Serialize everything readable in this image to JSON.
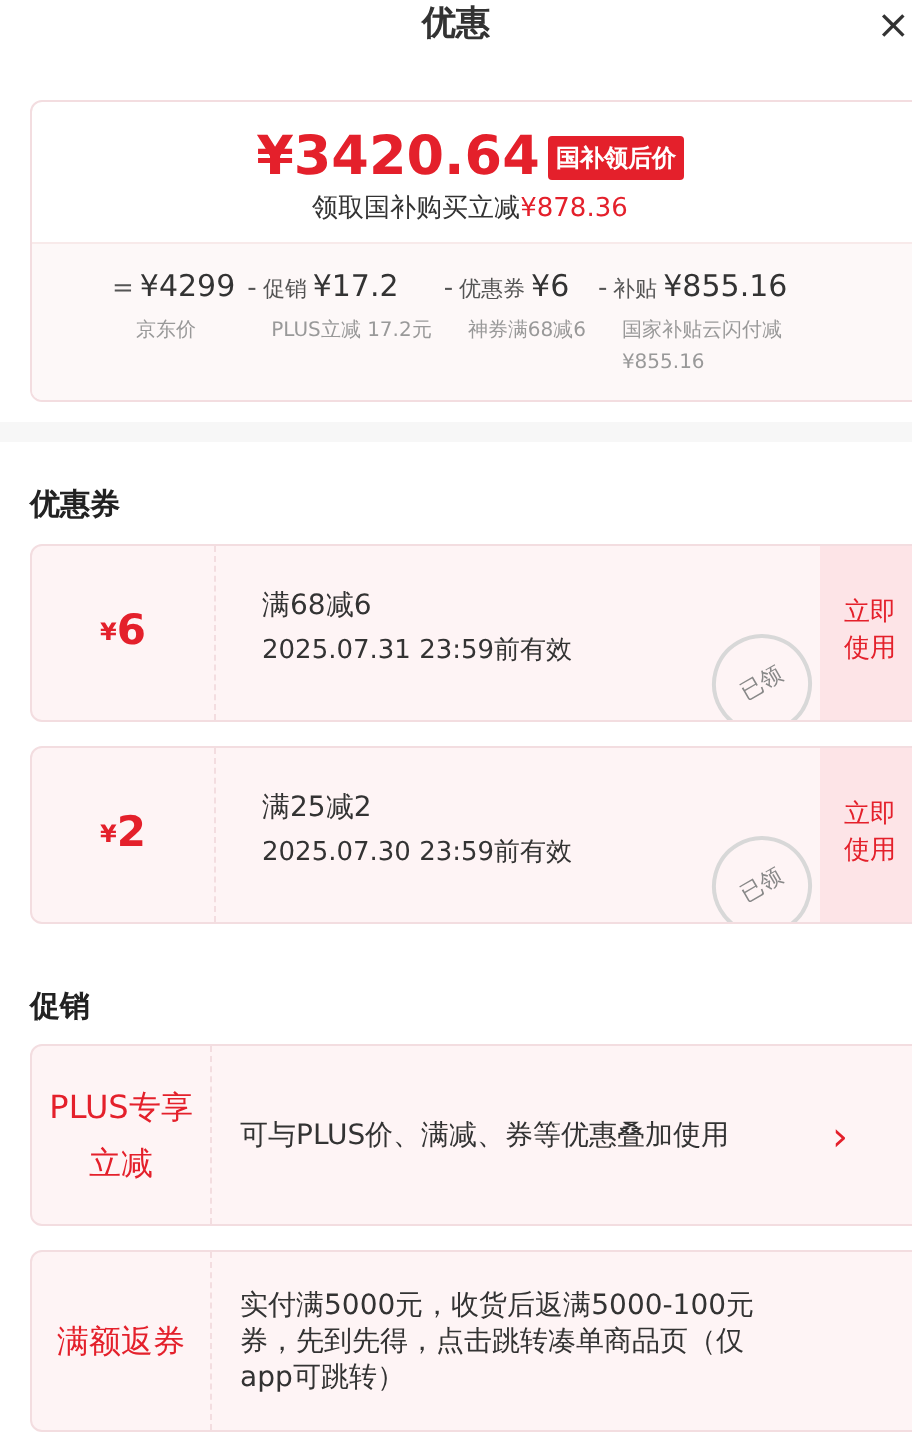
{
  "header": {
    "title": "优惠",
    "close": "×"
  },
  "summary": {
    "price": "¥3420.64",
    "badge": "国补领后价",
    "saving_label": "领取国补购买立减",
    "saving_amount": "¥878.36",
    "breakdown": [
      {
        "operator": "=",
        "amount": "¥4299",
        "note": "京东价"
      },
      {
        "operator": "-",
        "label": "促销",
        "amount": "¥17.2",
        "note": "PLUS立减 17.2元"
      },
      {
        "operator": "-",
        "label": "优惠券",
        "amount": "¥6",
        "note": "神券满68减6"
      },
      {
        "operator": "-",
        "label": "补贴",
        "amount": "¥855.16",
        "note": "国家补贴云闪付减¥855.16"
      }
    ]
  },
  "coupons": {
    "title": "优惠券",
    "items": [
      {
        "currency": "¥",
        "amount": "6",
        "condition": "满68减6",
        "validity": "2025.07.31 23:59前有效",
        "action": "立即使用",
        "stamp": "已领"
      },
      {
        "currency": "¥",
        "amount": "2",
        "condition": "满25减2",
        "validity": "2025.07.30 23:59前有效",
        "action": "立即使用",
        "stamp": "已领"
      }
    ]
  },
  "promotions": {
    "title": "促销",
    "items": [
      {
        "tag": "PLUS专享立减",
        "text": "可与PLUS价、满减、券等优惠叠加使用",
        "arrow": "›"
      },
      {
        "tag": "满额返券",
        "text": "实付满5000元，收货后返满5000-100元券，先到先得，点击跳转凑单商品页（仅app可跳转）"
      }
    ]
  }
}
